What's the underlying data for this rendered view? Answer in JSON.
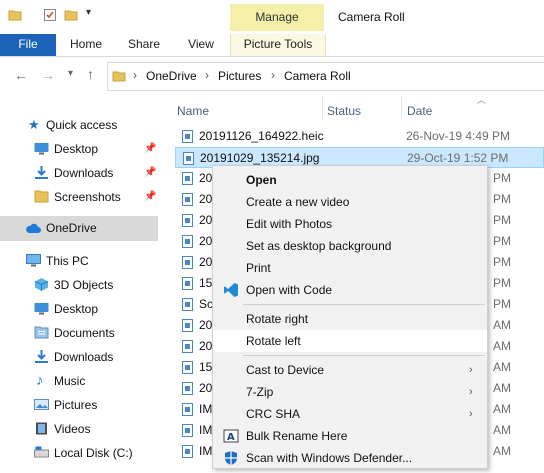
{
  "ribbon": {
    "manage_label": "Manage",
    "window_title": "Camera Roll",
    "tabs": [
      "File",
      "Home",
      "Share",
      "View",
      "Picture Tools"
    ]
  },
  "address": {
    "crumbs": [
      "OneDrive",
      "Pictures",
      "Camera Roll"
    ]
  },
  "sidebar": {
    "items": [
      {
        "label": "Quick access",
        "icon": "star-icon"
      },
      {
        "label": "Desktop",
        "icon": "desktop-folder-icon",
        "pinned": true
      },
      {
        "label": "Downloads",
        "icon": "downloads-icon",
        "pinned": true
      },
      {
        "label": "Screenshots",
        "icon": "folder-icon",
        "pinned": true
      },
      {
        "label": "OneDrive",
        "icon": "cloud-icon",
        "selected": true
      },
      {
        "label": "This PC",
        "icon": "computer-icon"
      },
      {
        "label": "3D Objects",
        "icon": "cube-icon"
      },
      {
        "label": "Desktop",
        "icon": "desktop-folder-icon"
      },
      {
        "label": "Documents",
        "icon": "documents-icon"
      },
      {
        "label": "Downloads",
        "icon": "downloads-icon"
      },
      {
        "label": "Music",
        "icon": "music-icon"
      },
      {
        "label": "Pictures",
        "icon": "pictures-icon"
      },
      {
        "label": "Videos",
        "icon": "videos-icon"
      },
      {
        "label": "Local Disk (C:)",
        "icon": "drive-icon"
      }
    ]
  },
  "columns": {
    "name": "Name",
    "status": "Status",
    "date": "Date"
  },
  "files": [
    {
      "name": "20191126_164922.heic",
      "date": "26-Nov-19 4:49 PM"
    },
    {
      "name": "20191029_135214.jpg",
      "date": "29-Oct-19 1:52 PM",
      "selected": true
    },
    {
      "name": "20",
      "date": "PM"
    },
    {
      "name": "20",
      "date": "PM"
    },
    {
      "name": "20",
      "date": "PM"
    },
    {
      "name": "20",
      "date": "PM"
    },
    {
      "name": "20",
      "date": "PM"
    },
    {
      "name": "15",
      "date": "PM"
    },
    {
      "name": "Sc",
      "date": "PM"
    },
    {
      "name": "20",
      "date": "AM"
    },
    {
      "name": "20",
      "date": "AM"
    },
    {
      "name": "15",
      "date": "AM"
    },
    {
      "name": "20",
      "date": "AM"
    },
    {
      "name": "IM",
      "date": "AM"
    },
    {
      "name": "IM",
      "date": "AM"
    },
    {
      "name": "IM",
      "date": "AM"
    }
  ],
  "context_menu": {
    "items": [
      {
        "label": "Open",
        "bold": true
      },
      {
        "label": "Create a new video"
      },
      {
        "label": "Edit with Photos"
      },
      {
        "label": "Set as desktop background"
      },
      {
        "label": "Print"
      },
      {
        "label": "Open with Code",
        "icon": "vscode-icon"
      },
      {
        "separator": true
      },
      {
        "label": "Rotate right"
      },
      {
        "label": "Rotate left",
        "hover": true
      },
      {
        "separator": true
      },
      {
        "label": "Cast to Device",
        "submenu": true
      },
      {
        "label": "7-Zip",
        "submenu": true
      },
      {
        "label": "CRC SHA",
        "submenu": true
      },
      {
        "label": "Bulk Rename Here",
        "icon": "bulk-rename-icon"
      },
      {
        "label": "Scan with Windows Defender...",
        "icon": "defender-icon"
      }
    ]
  },
  "colors": {
    "accent": "#1a63b8",
    "manage_bg": "#f4efa9",
    "selection": "#cce8ff"
  }
}
